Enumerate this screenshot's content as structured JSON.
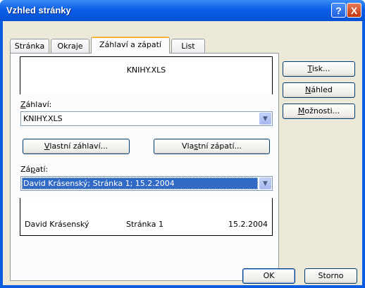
{
  "window": {
    "title": "Vzhled stránky",
    "help_label": "?",
    "close_label": "X"
  },
  "tabs": [
    {
      "label": "Stránka"
    },
    {
      "label": "Okraje"
    },
    {
      "label": "Záhlaví a zápatí"
    },
    {
      "label": "List"
    }
  ],
  "header": {
    "preview_text": "KNIHY.XLS",
    "label_prefix": "Z",
    "label_rest": "áhlaví:",
    "combo_value": "KNIHY.XLS",
    "custom_button": {
      "prefix": "",
      "accel": "V",
      "rest": "lastní záhlaví..."
    }
  },
  "footer": {
    "custom_button": {
      "prefix": "Vla",
      "accel": "s",
      "rest": "tní zápatí..."
    },
    "label_prefix": "Zá",
    "label_accel": "p",
    "label_rest": "atí:",
    "combo_value": "David Krásenský; Stránka 1; 15.2.2004",
    "preview_left": "David Krásenský",
    "preview_center": "Stránka 1",
    "preview_right": "15.2.2004"
  },
  "side_buttons": {
    "print": {
      "accel": "T",
      "rest": "isk..."
    },
    "preview": {
      "accel": "N",
      "rest": "áhled"
    },
    "options": {
      "accel": "M",
      "rest": "ožnosti..."
    }
  },
  "dialog_buttons": {
    "ok": "OK",
    "cancel": "Storno"
  },
  "icons": {
    "dropdown": "chevron-down-icon",
    "help": "help-icon",
    "close": "close-icon"
  }
}
